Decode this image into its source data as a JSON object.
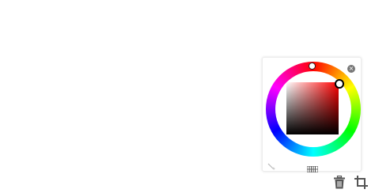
{
  "color_picker": {
    "hue_color": "#ff0000",
    "close_glyph": "×",
    "icons": {
      "close": "close-icon",
      "eyedropper": "eyedropper-icon",
      "palette": "palette-swatches-icon"
    }
  },
  "toolbar": {
    "icons": {
      "delete": "trash-icon",
      "crop": "crop-icon"
    }
  }
}
